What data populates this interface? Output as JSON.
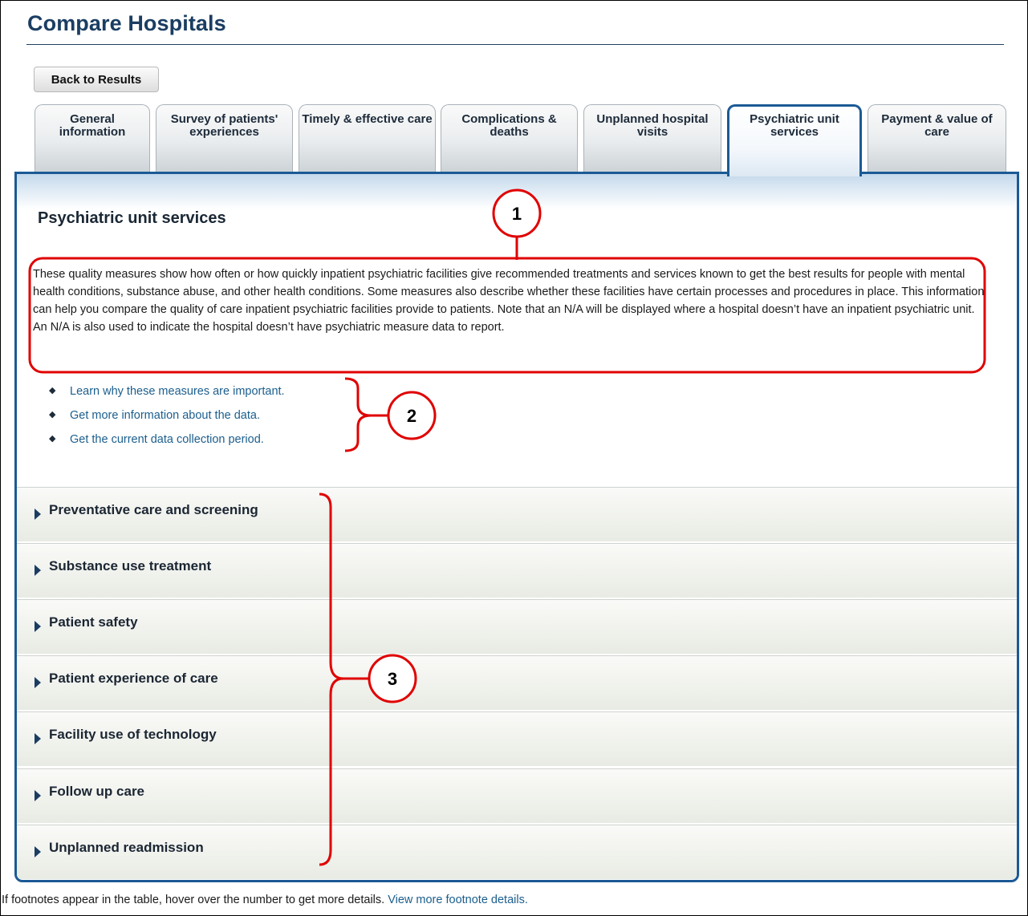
{
  "header": {
    "title": "Compare Hospitals",
    "back_label": "Back to Results"
  },
  "tabs": [
    {
      "label": "General information"
    },
    {
      "label": "Survey of patients' experiences"
    },
    {
      "label": "Timely & effective care"
    },
    {
      "label": "Complications & deaths"
    },
    {
      "label": "Unplanned hospital visits"
    },
    {
      "label": "Psychiatric unit services",
      "active": true
    },
    {
      "label": "Payment & value of care"
    }
  ],
  "panel": {
    "title": "Psychiatric unit services",
    "description": "These quality measures show how often or how quickly inpatient psychiatric facilities give recommended treatments and services known to get the best results for people with mental health conditions, substance abuse, and other health conditions. Some measures also describe whether these facilities have certain processes and procedures in place. This information can help you compare the quality of care inpatient psychiatric facilities provide to patients. Note that an N/A will be displayed where a hospital doesn’t have an inpatient psychiatric unit. An N/A is also used to indicate the hospital doesn’t have psychiatric measure data to report.",
    "links": [
      "Learn why these measures are important.",
      "Get more information about the data.",
      "Get the current data collection period."
    ],
    "sections": [
      "Preventative care and screening",
      "Substance use treatment",
      "Patient safety",
      "Patient experience of care",
      "Facility use of technology",
      "Follow up care",
      "Unplanned readmission"
    ]
  },
  "footnote": {
    "text": "If footnotes appear in the table, hover over the number to get more details.",
    "link": "View more footnote details."
  },
  "annotations": {
    "markers": [
      "1",
      "2",
      "3"
    ],
    "color": "#e00000"
  },
  "colors": {
    "brand_blue": "#1b5a95",
    "title_blue": "#1b3d62",
    "link_blue": "#1b5e8d"
  }
}
